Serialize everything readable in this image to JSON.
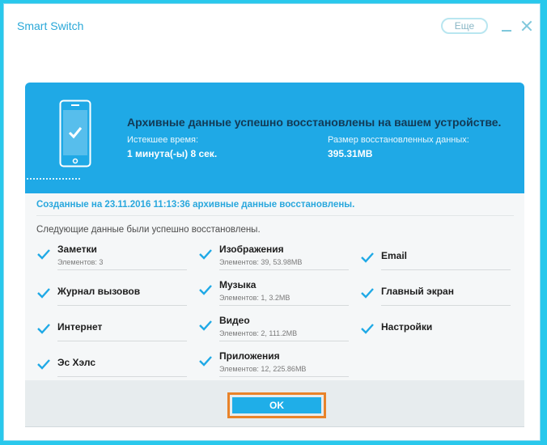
{
  "app": {
    "title": "Smart Switch",
    "more_label": "Еще"
  },
  "banner": {
    "title": "Архивные данные успешно восстановлены на вашем устройстве.",
    "elapsed_label": "Истекшее время:",
    "elapsed_value": "1 минута(-ы) 8 сек.",
    "size_label": "Размер восстановленных данных:",
    "size_value": "395.31MB"
  },
  "created_line": "Созданные на 23.11.2016 11:13:36 архивные данные восстановлены.",
  "list_heading": "Следующие данные были успешно восстановлены.",
  "items": [
    {
      "name": "Заметки",
      "sub": "Элементов: 3"
    },
    {
      "name": "Журнал вызовов",
      "sub": ""
    },
    {
      "name": "Интернет",
      "sub": ""
    },
    {
      "name": "Эс Хэлс",
      "sub": ""
    },
    {
      "name": "Изображения",
      "sub": "Элементов: 39, 53.98MB"
    },
    {
      "name": "Музыка",
      "sub": "Элементов: 1, 3.2MB"
    },
    {
      "name": "Видео",
      "sub": "Элементов: 2, 111.2MB"
    },
    {
      "name": "Приложения",
      "sub": "Элементов: 12, 225.86MB"
    },
    {
      "name": "Email",
      "sub": ""
    },
    {
      "name": "Главный экран",
      "sub": ""
    },
    {
      "name": "Настройки",
      "sub": ""
    }
  ],
  "ok_label": "OK",
  "colors": {
    "accent": "#1fa9e6",
    "highlight": "#e8832a",
    "background": "#29c8ec"
  }
}
